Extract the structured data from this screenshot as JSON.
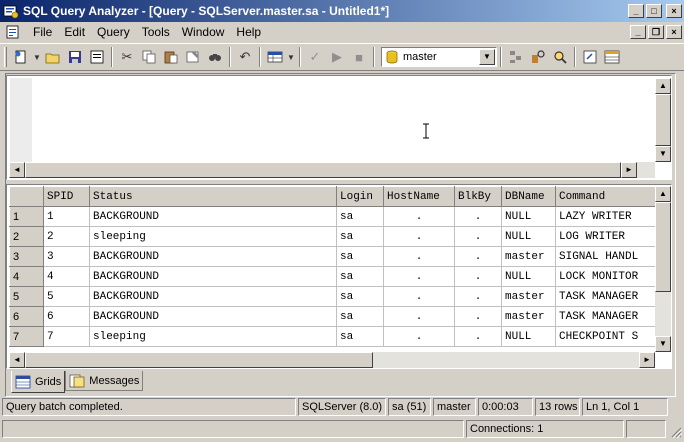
{
  "window": {
    "title": "SQL Query Analyzer - [Query - SQLServer.master.sa - Untitled1*]",
    "minimize": "_",
    "maximize": "□",
    "close": "×"
  },
  "menu": [
    "File",
    "Edit",
    "Query",
    "Tools",
    "Window",
    "Help"
  ],
  "mdi_buttons": {
    "minimize": "_",
    "restore": "❐",
    "close": "×"
  },
  "toolbar": {
    "database": "master",
    "icons": [
      "new-query-icon",
      "new-dropdown-icon",
      "open-icon",
      "save-icon",
      "load-sql-icon",
      "cut-icon",
      "copy-icon",
      "paste-icon",
      "clear-window-icon",
      "find-icon",
      "undo-icon",
      "results-mode-icon",
      "parse-icon",
      "execute-icon",
      "cancel-query-icon",
      "object-browser-icon",
      "object-search-icon",
      "show-plan-icon",
      "properties-icon",
      "grid-results-icon"
    ]
  },
  "results": {
    "columns": [
      "SPID",
      "Status",
      "Login",
      "HostName",
      "BlkBy",
      "DBName",
      "Command"
    ],
    "rows": [
      {
        "num": "1",
        "cells": [
          "1",
          "BACKGROUND",
          "sa",
          ".",
          ".",
          "NULL",
          "LAZY WRITER"
        ]
      },
      {
        "num": "2",
        "cells": [
          "2",
          "sleeping",
          "sa",
          ".",
          ".",
          "NULL",
          "LOG WRITER"
        ]
      },
      {
        "num": "3",
        "cells": [
          "3",
          "BACKGROUND",
          "sa",
          ".",
          ".",
          "master",
          "SIGNAL HANDL"
        ]
      },
      {
        "num": "4",
        "cells": [
          "4",
          "BACKGROUND",
          "sa",
          ".",
          ".",
          "NULL",
          "LOCK MONITOR"
        ]
      },
      {
        "num": "5",
        "cells": [
          "5",
          "BACKGROUND",
          "sa",
          ".",
          ".",
          "master",
          "TASK MANAGER"
        ]
      },
      {
        "num": "6",
        "cells": [
          "6",
          "BACKGROUND",
          "sa",
          ".",
          ".",
          "master",
          "TASK MANAGER"
        ]
      },
      {
        "num": "7",
        "cells": [
          "7",
          "sleeping",
          "sa",
          ".",
          ".",
          "NULL",
          "CHECKPOINT S"
        ]
      }
    ]
  },
  "tabs": [
    {
      "label": "Grids",
      "active": true
    },
    {
      "label": "Messages",
      "active": false
    }
  ],
  "status": {
    "message": "Query batch completed.",
    "server": "SQLServer (8.0)",
    "user": "sa (51)",
    "database": "master",
    "elapsed": "0:00:03",
    "rows": "13 rows",
    "position": "Ln 1, Col 1",
    "connections": "Connections: 1"
  },
  "colors": {
    "title_gradient_start": "#0a246a",
    "title_gradient_end": "#a6caf0",
    "face": "#d4d0c8"
  }
}
